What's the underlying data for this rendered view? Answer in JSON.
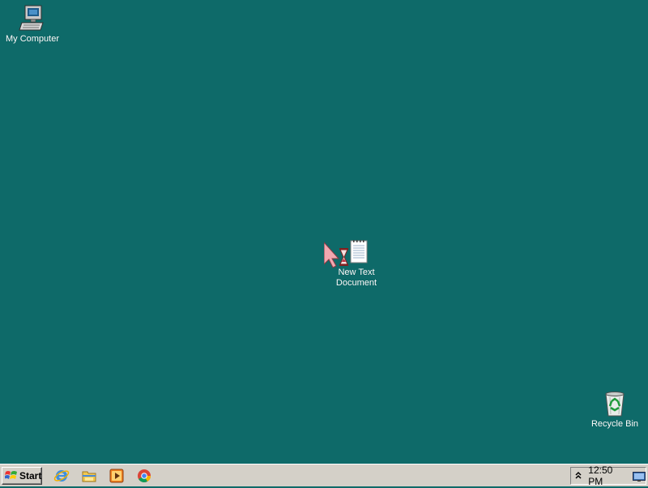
{
  "desktop": {
    "background_color": "#0e6a69",
    "icons": [
      {
        "label": "My Computer",
        "icon": "computer-icon"
      },
      {
        "label": "New Text\nDocument",
        "label_line1": "New Text",
        "label_line2": "Document",
        "icon": "text-document-icon"
      },
      {
        "label": "Recycle Bin",
        "icon": "recycle-bin-icon"
      }
    ],
    "cursor": {
      "icon": "busy-arrow-cursor-icon"
    }
  },
  "taskbar": {
    "start_label": "Start",
    "quick_launch": [
      {
        "icon": "internet-explorer-icon"
      },
      {
        "icon": "file-explorer-icon"
      },
      {
        "icon": "media-player-icon"
      },
      {
        "icon": "chrome-icon"
      }
    ],
    "tray": {
      "expand_icon": "chevron-up-icon",
      "clock": "12:50 PM",
      "network_icon": "network-icon"
    }
  }
}
